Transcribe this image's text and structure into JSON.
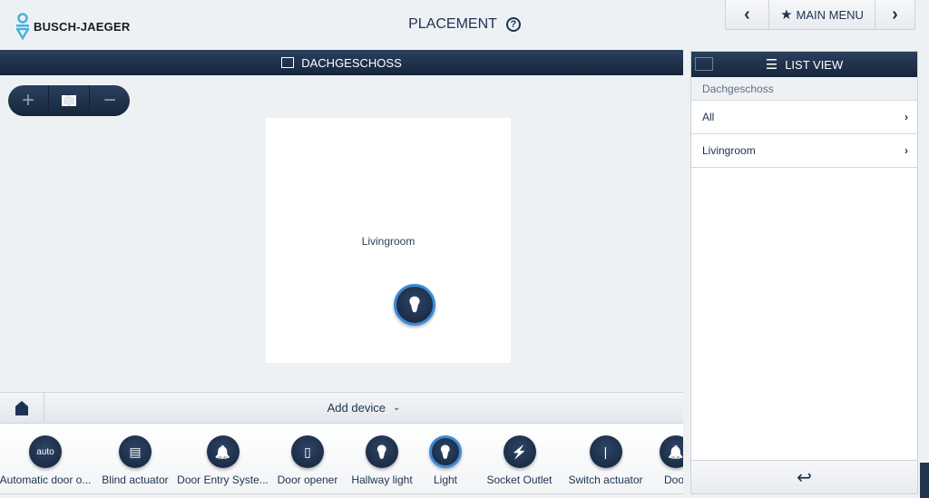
{
  "header": {
    "brand": "BUSCH-JAEGER",
    "title": "PLACEMENT",
    "help_icon": "?"
  },
  "nav": {
    "prev_icon": "‹",
    "main_menu": "MAIN MENU",
    "next_icon": "›"
  },
  "floor": {
    "name": "DACHGESCHOSS",
    "rooms": [
      {
        "name": "Livingroom"
      }
    ]
  },
  "bottom": {
    "add_device": "Add device"
  },
  "devices": [
    {
      "label": "Automatic door o...",
      "icon": "key-auto-icon",
      "glyph": "auto"
    },
    {
      "label": "Blind actuator",
      "icon": "blind-icon",
      "glyph": "▤"
    },
    {
      "label": "Door Entry Syste...",
      "icon": "door-entry-icon",
      "glyph": "🔔"
    },
    {
      "label": "Door opener",
      "icon": "door-icon",
      "glyph": "▯"
    },
    {
      "label": "Hallway light",
      "icon": "hallway-light-icon",
      "glyph": "💡"
    },
    {
      "label": "Light",
      "icon": "light-bulb-icon",
      "glyph": "💡",
      "selected": true
    },
    {
      "label": "Socket Outlet",
      "icon": "socket-icon",
      "glyph": "⚡"
    },
    {
      "label": "Switch actuator",
      "icon": "switch-icon",
      "glyph": "|"
    },
    {
      "label": "Door",
      "icon": "door-bell-icon",
      "glyph": "🔔"
    }
  ],
  "list_view": {
    "title": "LIST VIEW",
    "floor": "Dachgeschoss",
    "items": [
      {
        "label": "All"
      },
      {
        "label": "Livingroom"
      }
    ],
    "back_icon": "↩"
  },
  "colors": {
    "accent": "#3d8ad6",
    "bar": "#1d3250"
  }
}
